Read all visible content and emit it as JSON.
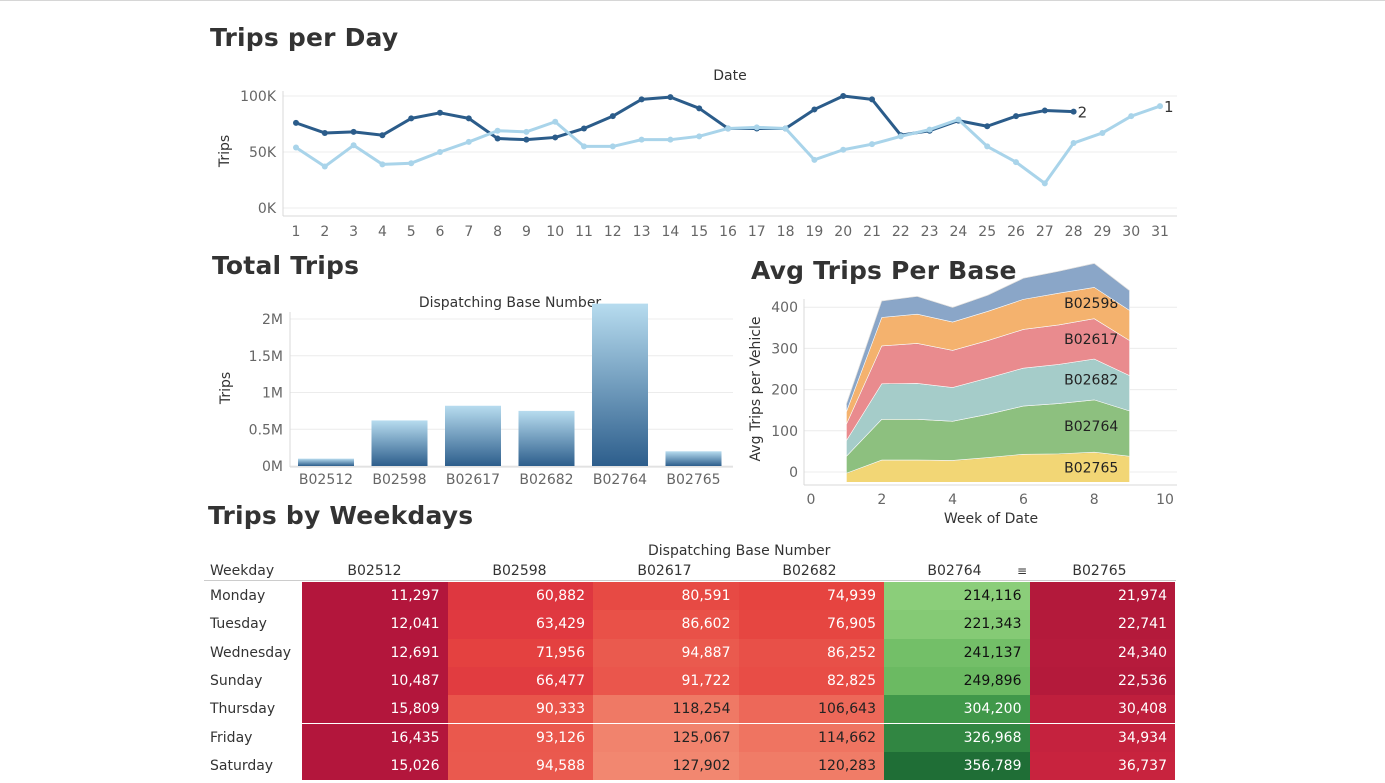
{
  "titles": {
    "trips_per_day": "Trips per Day",
    "total_trips": "Total Trips",
    "avg_trips": "Avg Trips Per Base",
    "weekdays": "Trips by Weekdays"
  },
  "colors": {
    "dark_blue": "#2b5c8a",
    "light_blue": "#a9d4ea",
    "area": [
      "#f2d675",
      "#8dc07f",
      "#a5ccc9",
      "#e98b8e",
      "#f4b26e",
      "#8aa6c8"
    ]
  },
  "chart_data": [
    {
      "type": "line",
      "title": "Trips per Day",
      "xlabel": "Date",
      "ylabel": "Trips",
      "x": [
        1,
        2,
        3,
        4,
        5,
        6,
        7,
        8,
        9,
        10,
        11,
        12,
        13,
        14,
        15,
        16,
        17,
        18,
        19,
        20,
        21,
        22,
        23,
        24,
        25,
        26,
        27,
        28,
        29,
        30,
        31
      ],
      "y_ticks": [
        "0K",
        "50K",
        "100K"
      ],
      "ylim": [
        0,
        100000
      ],
      "series": [
        {
          "name": "2",
          "values": [
            76000,
            67000,
            68000,
            65000,
            80000,
            85000,
            80000,
            62000,
            61000,
            63000,
            71000,
            82000,
            97000,
            99000,
            89000,
            71000,
            71000,
            71000,
            88000,
            100000,
            97000,
            65000,
            69000,
            78000,
            73000,
            82000,
            87000,
            86000
          ]
        },
        {
          "name": "1",
          "values": [
            54000,
            37000,
            56000,
            39000,
            40000,
            50000,
            59000,
            69000,
            68000,
            77000,
            55000,
            55000,
            61000,
            61000,
            64000,
            71000,
            72000,
            71000,
            43000,
            52000,
            57000,
            64000,
            70000,
            79000,
            55000,
            41000,
            22000,
            58000,
            67000,
            82000,
            91000
          ]
        }
      ]
    },
    {
      "type": "bar",
      "title": "Total Trips",
      "xlabel": "Dispatching Base Number",
      "ylabel": "Trips",
      "categories": [
        "B02512",
        "B02598",
        "B02617",
        "B02682",
        "B02764",
        "B02765"
      ],
      "values": [
        100000,
        620000,
        820000,
        750000,
        2210000,
        200000
      ],
      "y_ticks": [
        "0M",
        "0.5M",
        "1M",
        "1.5M",
        "2M"
      ],
      "ylim": [
        0,
        2300000
      ]
    },
    {
      "type": "area",
      "title": "Avg Trips Per Base",
      "xlabel": "Week of Date",
      "ylabel": "Avg Trips per Vehicle",
      "x": [
        1,
        2,
        3,
        4,
        5,
        6,
        7,
        8,
        9
      ],
      "x_ticks": [
        "0",
        "2",
        "4",
        "6",
        "8",
        "10"
      ],
      "y_ticks": [
        "0",
        "100",
        "200",
        "300",
        "400"
      ],
      "xlim": [
        0,
        10
      ],
      "ylim": [
        -25,
        410
      ],
      "series": [
        {
          "name": "B02765",
          "values": [
            22,
            54,
            54,
            53,
            60,
            68,
            69,
            73,
            63
          ]
        },
        {
          "name": "B02764",
          "values": [
            41,
            99,
            99,
            95,
            105,
            117,
            122,
            127,
            110
          ]
        },
        {
          "name": "B02682",
          "values": [
            38,
            86,
            87,
            82,
            88,
            92,
            95,
            99,
            86
          ]
        },
        {
          "name": "B02617",
          "values": [
            40,
            92,
            97,
            90,
            91,
            94,
            96,
            98,
            85
          ]
        },
        {
          "name": "B02598",
          "values": [
            30,
            69,
            71,
            69,
            71,
            73,
            77,
            76,
            73
          ]
        },
        {
          "name": "",
          "values": [
            18,
            40,
            43,
            35,
            39,
            51,
            53,
            58,
            48
          ]
        }
      ]
    },
    {
      "type": "heatmap",
      "title": "Trips by Weekdays",
      "column_title": "Dispatching Base Number",
      "row_header": "Weekday",
      "columns": [
        "B02512",
        "B02598",
        "B02617",
        "B02682",
        "B02764",
        "B02765"
      ],
      "rows": [
        {
          "day": "Monday",
          "values": [
            "11,297",
            "60,882",
            "80,591",
            "74,939",
            "214,116",
            "21,974"
          ]
        },
        {
          "day": "Tuesday",
          "values": [
            "12,041",
            "63,429",
            "86,602",
            "76,905",
            "221,343",
            "22,741"
          ]
        },
        {
          "day": "Wednesday",
          "values": [
            "12,691",
            "71,956",
            "94,887",
            "86,252",
            "241,137",
            "24,340"
          ]
        },
        {
          "day": "Sunday",
          "values": [
            "10,487",
            "66,477",
            "91,722",
            "82,825",
            "249,896",
            "22,536"
          ]
        },
        {
          "day": "Thursday",
          "values": [
            "15,809",
            "90,333",
            "118,254",
            "106,643",
            "304,200",
            "30,408"
          ]
        },
        {
          "day": "Friday",
          "values": [
            "16,435",
            "93,126",
            "125,067",
            "114,662",
            "326,968",
            "34,934"
          ]
        },
        {
          "day": "Saturday",
          "values": [
            "15,026",
            "94,588",
            "127,902",
            "120,283",
            "356,789",
            "36,737"
          ]
        }
      ]
    }
  ]
}
